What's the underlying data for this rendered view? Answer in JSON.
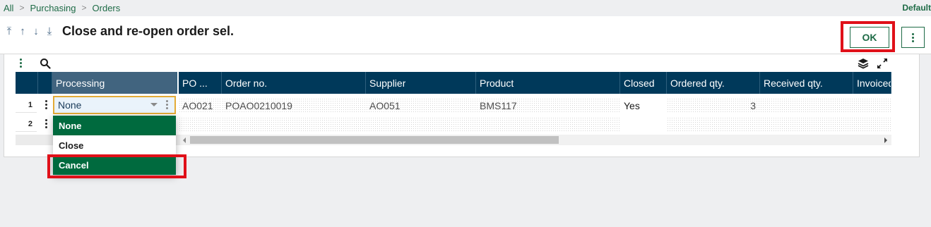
{
  "breadcrumb": {
    "items": [
      "All",
      "Purchasing",
      "Orders"
    ],
    "right_label": "Default"
  },
  "header": {
    "title": "Close and re-open order sel.",
    "ok_label": "OK"
  },
  "grid": {
    "columns": [
      "Processing",
      "PO ...",
      "Order no.",
      "Supplier",
      "Product",
      "Closed",
      "Ordered qty.",
      "Received qty.",
      "Invoiced"
    ],
    "rows": [
      {
        "num": "1",
        "processing": "None",
        "po": "AO021",
        "order_no": "POAO0210019",
        "supplier": "AO051",
        "product": "BMS117",
        "closed": "Yes",
        "ordered_qty": "3",
        "received_qty": ""
      },
      {
        "num": "2",
        "processing": "",
        "po": "",
        "order_no": "",
        "supplier": "",
        "product": "",
        "closed": "",
        "ordered_qty": "",
        "received_qty": ""
      }
    ]
  },
  "dropdown": {
    "options": [
      "None",
      "Close",
      "Cancel"
    ],
    "selected": "None"
  },
  "colors": {
    "accent": "#006a3e",
    "header_bg": "#00395a",
    "highlight": "#e01019",
    "focus": "#e3ab36"
  }
}
